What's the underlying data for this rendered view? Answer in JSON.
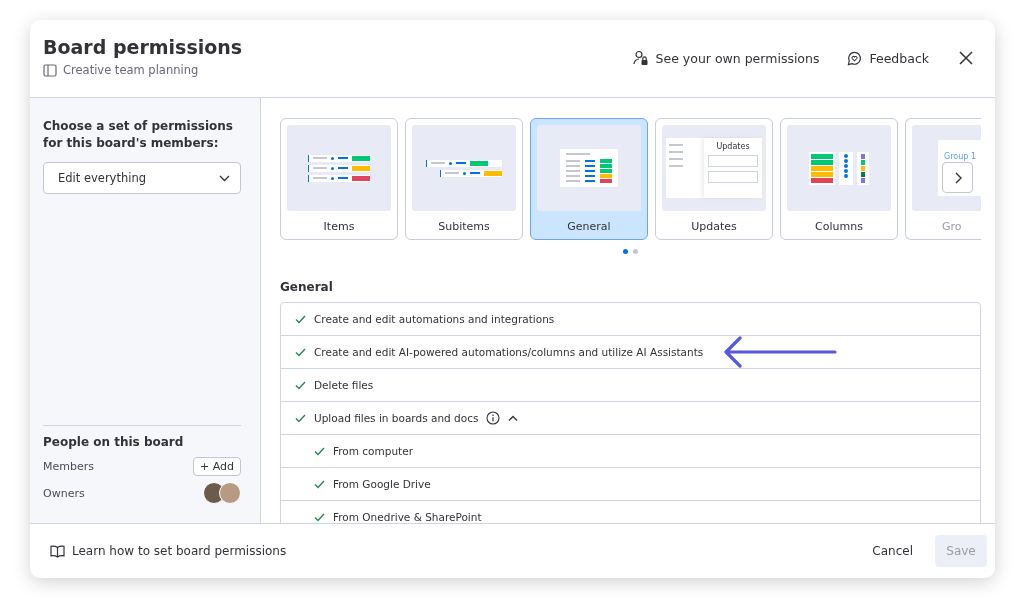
{
  "dialog": {
    "title": "Board permissions",
    "board_name": "Creative team planning",
    "own_permissions_link": "See your own permissions",
    "feedback_link": "Feedback"
  },
  "sidebar": {
    "prompt": "Choose a set of permissions for this board's members:",
    "dropdown_value": "Edit everything",
    "people_heading": "People on this board",
    "members_label": "Members",
    "add_button": "+ Add",
    "owners_label": "Owners",
    "owners": [
      {
        "kind": "dark"
      },
      {
        "kind": "light"
      }
    ]
  },
  "categories": [
    {
      "label": "Items",
      "kind": "items",
      "selected": false
    },
    {
      "label": "Subitems",
      "kind": "subitems",
      "selected": false
    },
    {
      "label": "General",
      "kind": "general",
      "selected": true
    },
    {
      "label": "Updates",
      "kind": "updates",
      "selected": false,
      "thumb_text": "Updates"
    },
    {
      "label": "Columns",
      "kind": "columns",
      "selected": false
    },
    {
      "label": "Gro",
      "kind": "groups",
      "selected": false,
      "partial": true,
      "thumb_text": "Group 1"
    }
  ],
  "carousel_pages": [
    {
      "selected": true
    },
    {
      "selected": false
    }
  ],
  "section": {
    "title": "General",
    "permissions": [
      {
        "label": "Create and edit automations and integrations",
        "checked": true
      },
      {
        "label": "Create and edit AI-powered automations/columns and utilize AI Assistants",
        "checked": true,
        "highlighted": true
      },
      {
        "label": "Delete files",
        "checked": true
      },
      {
        "label": "Upload files in boards and docs",
        "checked": true,
        "info": true,
        "expanded": true,
        "children": [
          {
            "label": "From computer",
            "checked": true
          },
          {
            "label": "From Google Drive",
            "checked": true
          },
          {
            "label": "From Onedrive & SharePoint",
            "checked": true
          }
        ]
      }
    ]
  },
  "footer": {
    "help_link": "Learn how to set board permissions",
    "cancel_button": "Cancel",
    "save_button": {
      "label": "Save",
      "disabled": true
    }
  }
}
